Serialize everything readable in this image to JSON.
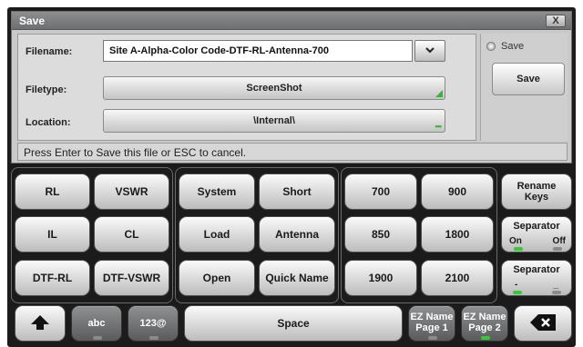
{
  "dialog": {
    "title": "Save",
    "close_label": "X",
    "filename_label": "Filename:",
    "filename_value": "Site A-Alpha-Color Code-DTF-RL-Antenna-700",
    "dropdown_arrow": "chevron-down-icon",
    "filetype_label": "Filetype:",
    "filetype_value": "ScreenShot",
    "location_label": "Location:",
    "location_value": "\\Internal\\",
    "save_radio_label": "Save",
    "save_button_label": "Save",
    "status_text": "Press Enter to Save this file or ESC to cancel."
  },
  "keyboard": {
    "group1": [
      "RL",
      "VSWR",
      "IL",
      "CL",
      "DTF-RL",
      "DTF-VSWR"
    ],
    "group2": [
      "System",
      "Short",
      "Load",
      "Antenna",
      "Open",
      "Quick Name"
    ],
    "group3": [
      "700",
      "900",
      "850",
      "1800",
      "1900",
      "2100"
    ],
    "rename_keys": "Rename Keys",
    "separator_onoff": {
      "title": "Separator",
      "on": "On",
      "off": "Off"
    },
    "separator_char": {
      "title": "Separator",
      "left": "-",
      "right": "_"
    },
    "shift_icon": "shift-up-arrow-icon",
    "abc": "abc",
    "num": "123@",
    "space": "Space",
    "ez1_line1": "EZ Name",
    "ez1_line2": "Page 1",
    "ez2_line1": "EZ Name",
    "ez2_line2": "Page 2",
    "backspace_icon": "backspace-icon"
  },
  "colors": {
    "led_green": "#39c739",
    "accent_green": "#3bb33b",
    "screen_bg": "#1b1b1b"
  }
}
